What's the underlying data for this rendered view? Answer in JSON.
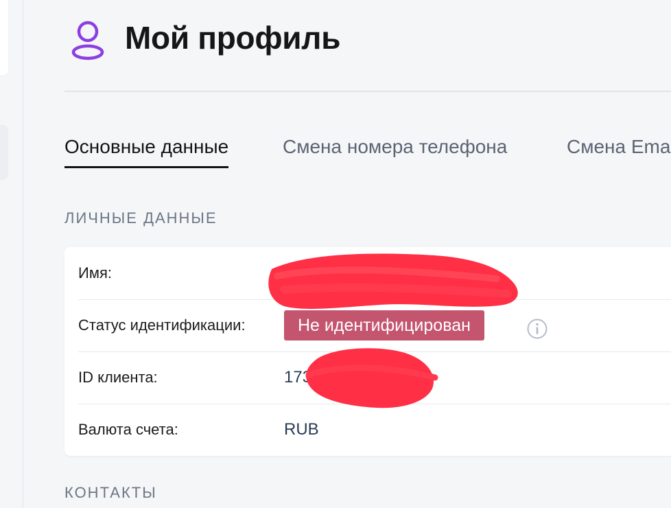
{
  "header": {
    "title": "Мой профиль"
  },
  "tabs": [
    {
      "label": "Основные данные",
      "active": true
    },
    {
      "label": "Смена номера телефона",
      "active": false
    },
    {
      "label": "Смена Email",
      "active": false
    }
  ],
  "personal": {
    "section_label": "ЛИЧНЫЕ ДАННЫЕ",
    "rows": {
      "name": {
        "label": "Имя:",
        "value": ""
      },
      "status": {
        "label": "Статус идентификации:",
        "badge": "Не идентифицирован"
      },
      "client_id": {
        "label": "ID клиента:",
        "value": "173"
      },
      "currency": {
        "label": "Валюта счета:",
        "value": "RUB"
      }
    }
  },
  "contacts": {
    "section_label": "КОНТАКТЫ"
  },
  "colors": {
    "accent_icon": "#8b3fe0",
    "status_badge": "#c4556e",
    "redaction": "#ff2f45"
  },
  "icons": {
    "profile": "user-profile-icon",
    "info": "info-icon"
  }
}
